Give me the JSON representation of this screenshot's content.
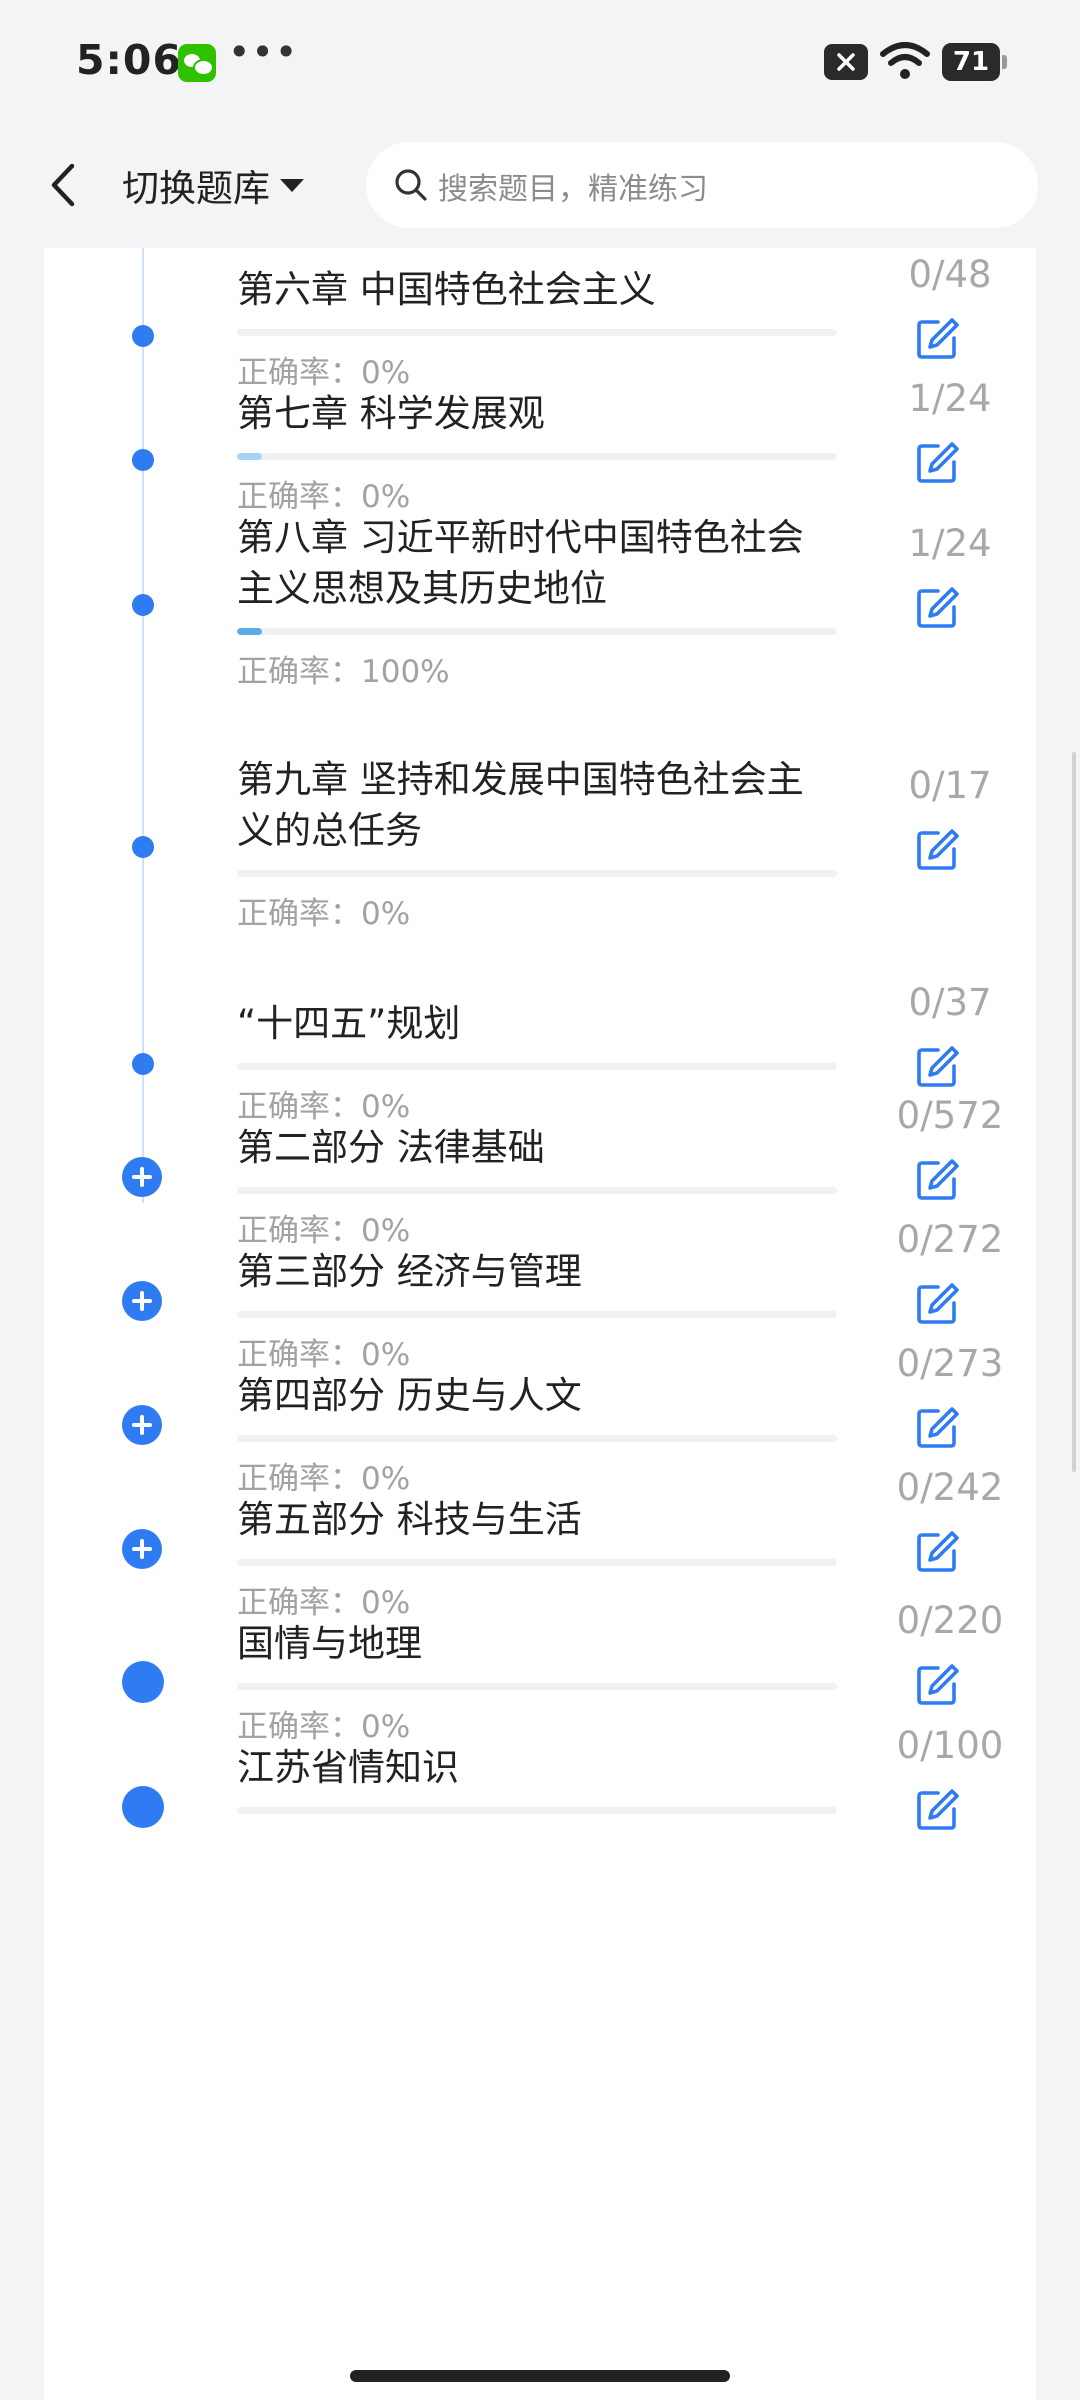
{
  "status_bar": {
    "time": "5:06",
    "dots": "•••",
    "battery": "71"
  },
  "header": {
    "bank_title": "切换题库",
    "search_placeholder": "搜索题目，精准练习"
  },
  "items": [
    {
      "title": "第六章 中国特色社会主义",
      "accuracy": "正确率：0%",
      "count": "0/48",
      "node": "dot",
      "progress": 0
    },
    {
      "title": "第七章 科学发展观",
      "accuracy": "正确率：0%",
      "count": "1/24",
      "node": "dot",
      "progress": 0.0417
    },
    {
      "title": "第八章 习近平新时代中国特色社会主义思想及其历史地位",
      "accuracy": "正确率：100%",
      "count": "1/24",
      "node": "dot",
      "progress": 0.0417
    },
    {
      "title": "第九章 坚持和发展中国特色社会主义的总任务",
      "accuracy": "正确率：0%",
      "count": "0/17",
      "node": "dot",
      "progress": 0
    },
    {
      "title": "“十四五”规划",
      "accuracy": "正确率：0%",
      "count": "0/37",
      "node": "dot",
      "progress": 0
    },
    {
      "title": "第二部分 法律基础",
      "accuracy": "正确率：0%",
      "count": "0/572",
      "node": "plus",
      "progress": 0
    },
    {
      "title": "第三部分 经济与管理",
      "accuracy": "正确率：0%",
      "count": "0/272",
      "node": "plus",
      "progress": 0
    },
    {
      "title": "第四部分 历史与人文",
      "accuracy": "正确率：0%",
      "count": "0/273",
      "node": "plus",
      "progress": 0
    },
    {
      "title": "第五部分 科技与生活",
      "accuracy": "正确率：0%",
      "count": "0/242",
      "node": "plus",
      "progress": 0
    },
    {
      "title": "国情与地理",
      "accuracy": "正确率：0%",
      "count": "0/220",
      "node": "big",
      "progress": 0
    },
    {
      "title": "江苏省情知识",
      "accuracy": "",
      "count": "0/100",
      "node": "big",
      "progress": 0
    }
  ],
  "colors": {
    "accent": "#2f7cf2",
    "progress": "#5aaee8",
    "muted_text": "#a2a2a2"
  },
  "icons": {
    "back": "chevron-left-icon",
    "search": "search-icon",
    "edit": "edit-pencil-icon"
  }
}
